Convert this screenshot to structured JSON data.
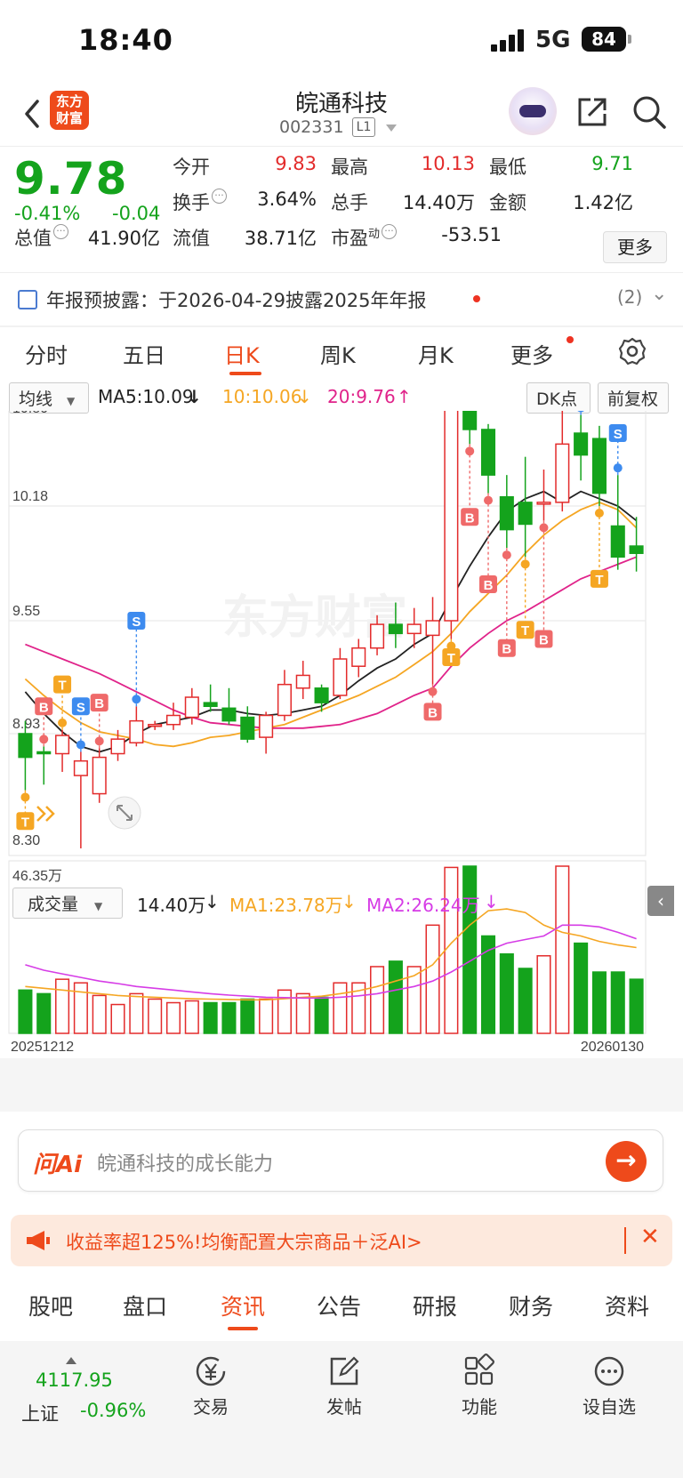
{
  "status": {
    "time": "18:40",
    "network": "5G",
    "battery": "84"
  },
  "header": {
    "brand_logo": "东方财富",
    "title": "皖通科技",
    "code": "002331",
    "level": "L1"
  },
  "quote": {
    "price": "9.78",
    "change_pct": "-0.41%",
    "change": "-0.04",
    "fields": [
      {
        "label": "今开",
        "value": "9.83",
        "color": "#e32b2b"
      },
      {
        "label": "最高",
        "value": "10.13",
        "color": "#e32b2b"
      },
      {
        "label": "最低",
        "value": "9.71",
        "color": "#14a31c"
      },
      {
        "label": "换手",
        "value": "3.64%",
        "color": "#222222"
      },
      {
        "label": "总手",
        "value": "14.40万",
        "color": "#222222"
      },
      {
        "label": "金额",
        "value": "1.42亿",
        "color": "#222222"
      },
      {
        "label": "总值",
        "value": "41.90亿",
        "color": "#222222"
      },
      {
        "label": "流值",
        "value": "38.71亿",
        "color": "#222222"
      },
      {
        "label": "市盈",
        "label_sup": "动",
        "value": "-53.51",
        "color": "#222222"
      }
    ],
    "more_label": "更多"
  },
  "notice": {
    "text": "年报预披露：于2026-04-29披露2025年年报",
    "count": "(2)"
  },
  "tabs": [
    "分时",
    "五日",
    "日K",
    "周K",
    "月K",
    "更多"
  ],
  "active_tab": "日K",
  "ma_bar": {
    "selector": "均线",
    "ma5": "MA5:10.09",
    "ma10": "10:10.06",
    "ma20": "20:9.76",
    "dk": "DK点",
    "adjust": "前复权"
  },
  "volume_bar": {
    "selector": "成交量",
    "vol": "14.40万",
    "ma1": "MA1:23.78万",
    "ma2": "MA2:26.24万"
  },
  "chart_data": [
    {
      "type": "candlestick",
      "y_tick_labels": [
        "10.80",
        "10.18",
        "9.55",
        "8.93",
        "8.30"
      ],
      "ylim": [
        8.3,
        10.8
      ],
      "watermark": "东方财富",
      "candles": [
        [
          8.93,
          8.8,
          9.0,
          8.62
        ],
        [
          8.83,
          8.82,
          8.86,
          8.65
        ],
        [
          8.82,
          8.92,
          8.95,
          8.72
        ],
        [
          8.7,
          8.78,
          8.83,
          8.3
        ],
        [
          8.6,
          8.8,
          8.85,
          8.55
        ],
        [
          8.82,
          8.9,
          8.95,
          8.78
        ],
        [
          8.88,
          9.0,
          9.08,
          8.86
        ],
        [
          8.98,
          8.98,
          9.0,
          8.95
        ],
        [
          8.98,
          9.03,
          9.1,
          8.95
        ],
        [
          9.02,
          9.13,
          9.18,
          8.98
        ],
        [
          9.1,
          9.08,
          9.2,
          9.05
        ],
        [
          9.07,
          9.0,
          9.18,
          8.98
        ],
        [
          9.02,
          8.9,
          9.08,
          8.88
        ],
        [
          8.91,
          9.03,
          9.05,
          8.82
        ],
        [
          9.03,
          9.2,
          9.28,
          9.0
        ],
        [
          9.18,
          9.25,
          9.33,
          9.12
        ],
        [
          9.18,
          9.1,
          9.2,
          9.05
        ],
        [
          9.14,
          9.34,
          9.4,
          9.12
        ],
        [
          9.3,
          9.4,
          9.45,
          9.24
        ],
        [
          9.4,
          9.53,
          9.58,
          9.36
        ],
        [
          9.53,
          9.48,
          9.65,
          9.4
        ],
        [
          9.48,
          9.53,
          9.62,
          9.4
        ],
        [
          9.47,
          9.55,
          9.68,
          9.2
        ],
        [
          9.55,
          10.81,
          10.82,
          9.45
        ],
        [
          10.7,
          10.6,
          10.75,
          10.52
        ],
        [
          10.6,
          10.35,
          10.63,
          10.25
        ],
        [
          10.23,
          10.05,
          10.35,
          9.95
        ],
        [
          10.2,
          10.08,
          10.45,
          9.9
        ],
        [
          10.2,
          10.2,
          10.38,
          10.1
        ],
        [
          10.2,
          10.52,
          10.96,
          10.15
        ],
        [
          10.58,
          10.46,
          10.68,
          10.32
        ],
        [
          10.55,
          10.25,
          10.62,
          10.18
        ],
        [
          10.07,
          9.9,
          10.35,
          9.83
        ],
        [
          9.96,
          9.92,
          10.12,
          9.82
        ]
      ],
      "ma_lines": [
        {
          "name": "MA5",
          "color": "#222222",
          "values": [
            9.16,
            9.04,
            8.94,
            8.86,
            8.83,
            8.86,
            8.93,
            8.98,
            9.0,
            9.02,
            9.06,
            9.06,
            9.04,
            9.03,
            9.04,
            9.06,
            9.08,
            9.14,
            9.22,
            9.29,
            9.34,
            9.42,
            9.48,
            9.67,
            9.85,
            10.01,
            10.15,
            10.22,
            10.26,
            10.2,
            10.26,
            10.22,
            10.18,
            10.1
          ]
        },
        {
          "name": "MA10",
          "color": "#f5a623",
          "values": [
            9.23,
            9.14,
            9.06,
            8.99,
            8.94,
            8.92,
            8.9,
            8.87,
            8.86,
            8.88,
            8.91,
            8.92,
            8.94,
            8.96,
            8.98,
            9.02,
            9.06,
            9.1,
            9.14,
            9.19,
            9.24,
            9.31,
            9.38,
            9.48,
            9.6,
            9.7,
            9.8,
            9.92,
            10.02,
            10.1,
            10.16,
            10.2,
            10.16,
            10.06
          ]
        },
        {
          "name": "MA20",
          "color": "#e0238a",
          "values": [
            9.42,
            9.38,
            9.34,
            9.3,
            9.26,
            9.21,
            9.16,
            9.11,
            9.06,
            9.02,
            8.99,
            8.98,
            8.97,
            8.96,
            8.96,
            8.96,
            8.97,
            8.98,
            9.01,
            9.04,
            9.09,
            9.14,
            9.18,
            9.3,
            9.4,
            9.48,
            9.55,
            9.6,
            9.66,
            9.72,
            9.78,
            9.82,
            9.86,
            9.9
          ]
        }
      ],
      "markers": [
        {
          "i": 0,
          "label": "T",
          "price": 8.45,
          "kind": "orange",
          "dir": "down"
        },
        {
          "i": 1,
          "label": "B",
          "price": 9.08,
          "kind": "red",
          "dir": "up"
        },
        {
          "i": 2,
          "label": "T",
          "price": 9.2,
          "kind": "orange",
          "dir": "up"
        },
        {
          "i": 3,
          "label": "S",
          "price": 9.08,
          "kind": "blue",
          "dir": "up"
        },
        {
          "i": 4,
          "label": "B",
          "price": 9.1,
          "kind": "red",
          "dir": "up"
        },
        {
          "i": 6,
          "label": "S",
          "price": 9.55,
          "kind": "blue",
          "dir": "up"
        },
        {
          "i": 22,
          "label": "B",
          "price": 9.05,
          "kind": "red",
          "dir": "down"
        },
        {
          "i": 23,
          "label": "T",
          "price": 9.35,
          "kind": "orange",
          "dir": "down"
        },
        {
          "i": 24,
          "label": "B",
          "price": 10.12,
          "kind": "red",
          "dir": "down"
        },
        {
          "i": 25,
          "label": "B",
          "price": 9.75,
          "kind": "red",
          "dir": "down"
        },
        {
          "i": 26,
          "label": "B",
          "price": 9.4,
          "kind": "red",
          "dir": "down"
        },
        {
          "i": 27,
          "label": "T",
          "price": 9.5,
          "kind": "orange",
          "dir": "down"
        },
        {
          "i": 28,
          "label": "B",
          "price": 9.45,
          "kind": "red",
          "dir": "down"
        },
        {
          "i": 30,
          "label": "S",
          "price": 10.76,
          "kind": "blue",
          "dir": "up"
        },
        {
          "i": 32,
          "label": "S",
          "price": 10.58,
          "kind": "blue",
          "dir": "up"
        },
        {
          "i": 31,
          "label": "T",
          "price": 9.78,
          "kind": "orange",
          "dir": "down"
        }
      ]
    },
    {
      "type": "bar",
      "y_tick_labels": [
        "46.35万"
      ],
      "x_tick_labels": [
        "20251212",
        "20260130"
      ],
      "ylim": [
        0,
        46.35
      ],
      "volume": [
        12,
        11,
        15,
        14,
        10.5,
        8,
        11,
        9.5,
        8.5,
        9,
        8.5,
        8.5,
        9.5,
        9.5,
        12,
        11,
        10,
        14,
        14,
        18.5,
        20,
        18.5,
        30,
        46,
        46.35,
        27,
        22,
        18,
        21.5,
        46.35,
        25,
        17,
        17,
        15
      ],
      "ma_lines": [
        {
          "name": "MA1",
          "color": "#f5a623",
          "values": [
            13,
            12.5,
            12,
            11.5,
            11,
            10.5,
            10.2,
            10,
            9.8,
            9.6,
            9.5,
            9.4,
            9.3,
            9.3,
            9.6,
            10,
            10.3,
            11,
            11.8,
            13,
            14.5,
            16,
            19,
            25,
            30,
            34,
            34.5,
            33.5,
            30,
            28,
            27,
            25.5,
            24.5,
            23.78
          ]
        },
        {
          "name": "MA2",
          "color": "#d63ce6",
          "values": [
            19,
            17.5,
            16.5,
            15.5,
            14.5,
            13.8,
            13,
            12.5,
            12,
            11.5,
            11,
            10.6,
            10.3,
            10,
            9.9,
            9.8,
            9.8,
            10,
            10.4,
            11,
            12,
            13,
            14.5,
            17,
            20,
            23,
            25,
            26,
            27,
            30,
            30,
            29.5,
            28,
            26.24
          ]
        }
      ]
    }
  ],
  "ai_bar": {
    "logo": "问Ai",
    "placeholder": "皖通科技的成长能力"
  },
  "ad": {
    "text": "收益率超125%!均衡配置大宗商品＋泛AI>"
  },
  "bottom_tabs": [
    "股吧",
    "盘口",
    "资讯",
    "公告",
    "研报",
    "财务",
    "资料"
  ],
  "bottom_active": "资讯",
  "nav": {
    "index_value": "4117.95",
    "index_name": "上证",
    "index_pct": "-0.96%",
    "items": [
      {
        "label": "交易",
        "icon": "yen-icon"
      },
      {
        "label": "发帖",
        "icon": "edit-icon"
      },
      {
        "label": "功能",
        "icon": "grid-icon"
      },
      {
        "label": "设自选",
        "icon": "more-dots-icon"
      }
    ]
  },
  "colors": {
    "up": "#e32b2b",
    "down": "#14a31c",
    "accent": "#ee4a1b"
  }
}
